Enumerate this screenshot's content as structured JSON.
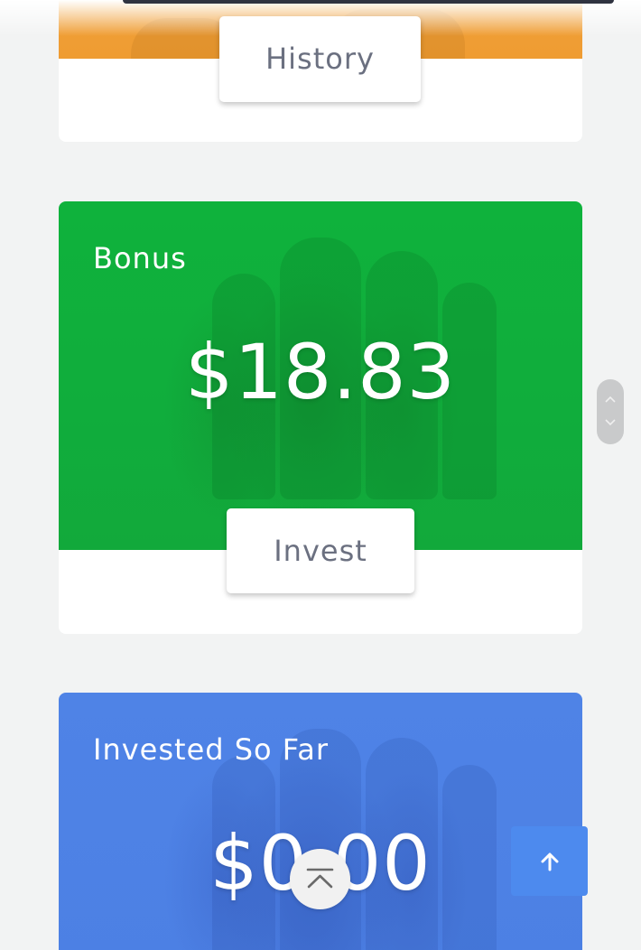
{
  "cards": {
    "history": {
      "button_label": "History"
    },
    "bonus": {
      "label": "Bonus",
      "amount": "$18.83",
      "button_label": "Invest"
    },
    "invested": {
      "label": "Invested So Far",
      "amount": "$0.00"
    }
  },
  "icons": {
    "scroll_up": "chevron-up-icon",
    "scroll_down": "chevron-down-icon",
    "back_to_top": "arrow-up-icon",
    "scroll_to_top": "double-chevron-up-icon"
  },
  "colors": {
    "history_hero": "#ef9c32",
    "bonus_hero": "#10ad3c",
    "invested_hero": "#4e82e5",
    "back_to_top_button": "#4d8aee",
    "button_text": "#6b7080",
    "page_background": "#f2f3f3"
  }
}
